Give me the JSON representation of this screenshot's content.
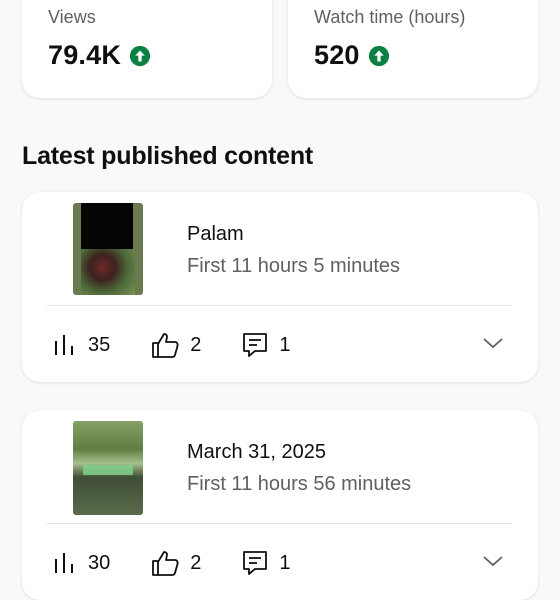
{
  "stats": {
    "views": {
      "label": "Views",
      "value": "79.4K",
      "trend_icon": "arrow-up-circle-icon"
    },
    "watch_time": {
      "label": "Watch time (hours)",
      "value": "520",
      "trend_icon": "arrow-up-circle-icon"
    }
  },
  "section_title": "Latest published content",
  "items": [
    {
      "title": "Palam",
      "subtitle": "First 11 hours 5 minutes",
      "views": "35",
      "likes": "2",
      "comments": "1"
    },
    {
      "title": "March 31, 2025",
      "subtitle": "First 11 hours 56 minutes",
      "views": "30",
      "likes": "2",
      "comments": "1"
    }
  ],
  "colors": {
    "trend_up": "#0b8043",
    "background": "#f9f9f9",
    "card": "#ffffff",
    "secondary_text": "#606060"
  }
}
